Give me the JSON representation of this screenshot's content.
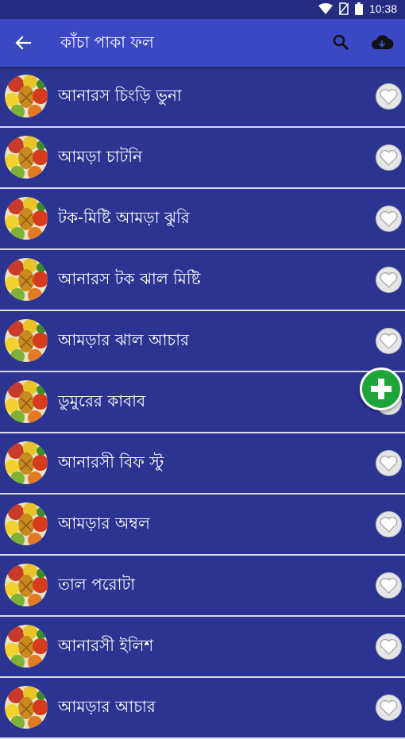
{
  "status": {
    "time": "10:38"
  },
  "appbar": {
    "title": "কাঁচা পাকা ফল"
  },
  "icons": {
    "back": "arrow-back-icon",
    "search": "search-icon",
    "download": "cloud-download-icon",
    "favorite": "heart-icon",
    "add": "plus-icon"
  },
  "colors": {
    "background": "#2b3591",
    "appbar": "#3b48c4",
    "statusbar": "#232c80",
    "fab": "#1fa43a",
    "divider": "#d9dbe9"
  },
  "recipes": [
    {
      "label": "আনারস চিংড়ি ভুনা"
    },
    {
      "label": "আমড়া চাটনি"
    },
    {
      "label": "টক-মিষ্টি আমড়া ঝুরি"
    },
    {
      "label": "আনারস টক ঝাল মিষ্টি"
    },
    {
      "label": "আমড়ার ঝাল আচার"
    },
    {
      "label": "ডুমুরের কাবাব"
    },
    {
      "label": "আনারসী বিফ স্টু"
    },
    {
      "label": "আমড়ার অম্বল"
    },
    {
      "label": "তাল পরোটা"
    },
    {
      "label": "আনারসী ইলিশ"
    },
    {
      "label": "আমড়ার আচার"
    }
  ]
}
